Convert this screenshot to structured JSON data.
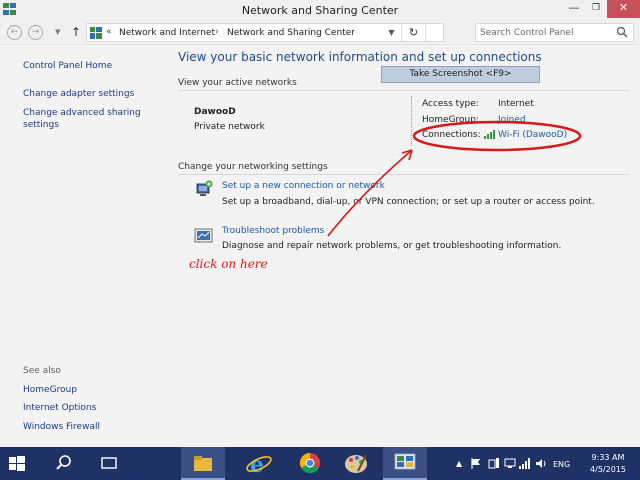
{
  "window": {
    "title": "Network and Sharing Center",
    "minimize": "—",
    "maximize": "❐",
    "close": "✕"
  },
  "address_bar": {
    "prefix": "«",
    "crumbs": [
      "Network and Internet",
      "Network and Sharing Center"
    ],
    "separator": "›"
  },
  "search": {
    "placeholder": "Search Control Panel"
  },
  "left_pane": {
    "links": [
      "Control Panel Home",
      "Change adapter settings",
      "Change advanced sharing settings"
    ],
    "see_also_heading": "See also",
    "see_also_links": [
      "HomeGroup",
      "Internet Options",
      "Windows Firewall"
    ]
  },
  "main": {
    "title": "View your basic network information and set up connections",
    "active_networks_heading": "View your active networks",
    "network": {
      "name": "DawooD",
      "type": "Private network",
      "access_type_label": "Access type:",
      "access_type_value": "Internet",
      "homegroup_label": "HomeGroup:",
      "homegroup_value": "Joined",
      "connections_label": "Connections:",
      "connections_value": "Wi-Fi (DawooD)"
    },
    "settings_heading": "Change your networking settings",
    "tasks": [
      {
        "link": "Set up a new connection or network",
        "desc": "Set up a broadband, dial-up, or VPN connection; or set up a router or access point."
      },
      {
        "link": "Troubleshoot problems",
        "desc": "Diagnose and repair network problems, or get troubleshooting information."
      }
    ]
  },
  "overlay": {
    "tooltip": "Take Screenshot <F9>",
    "annotation": "click on here",
    "annotation_color": "#d61a1a"
  },
  "taskbar": {
    "language": "ENG",
    "time": "9:33 AM",
    "date": "4/5/2015",
    "apps": [
      "start-icon",
      "search-icon",
      "task-view-icon",
      "file-explorer-icon",
      "internet-explorer-icon",
      "chrome-icon",
      "paint-icon",
      "control-panel-icon"
    ],
    "color": "#1f3266"
  },
  "colors": {
    "link": "#1a5aa8",
    "title": "#1d4b8f",
    "close": "#c7505b"
  }
}
